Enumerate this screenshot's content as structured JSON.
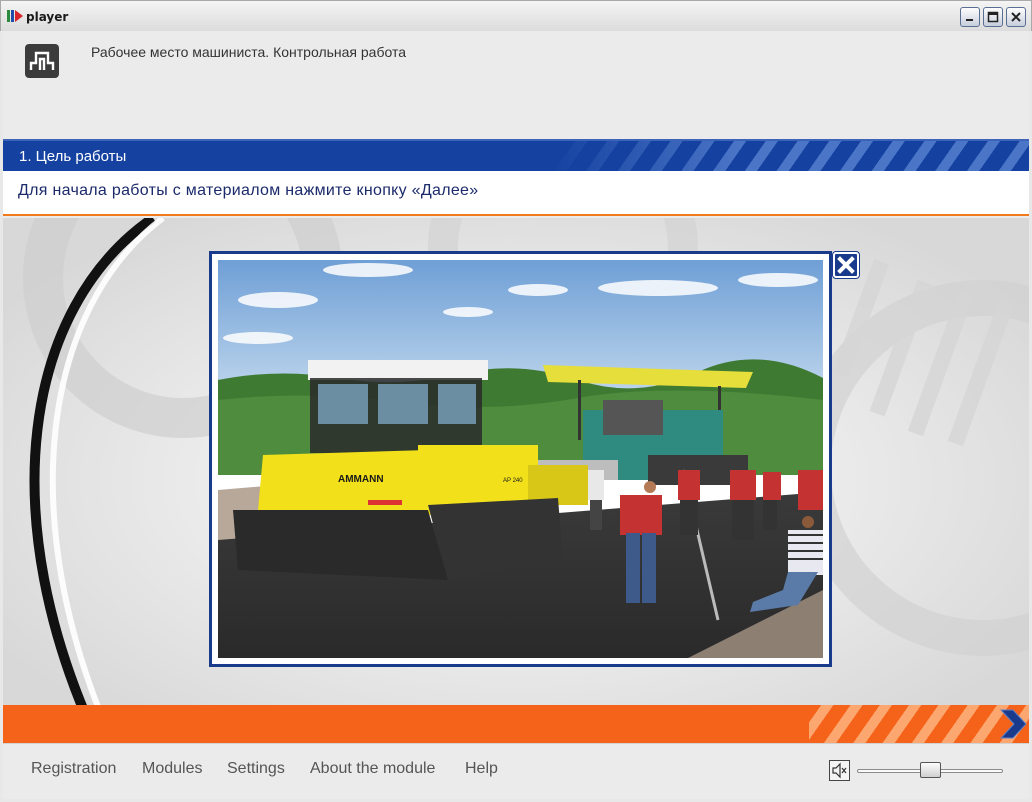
{
  "window": {
    "title": "player",
    "icon": "player-app-icon",
    "controls": [
      "minimize-icon",
      "maximize-icon",
      "close-icon"
    ]
  },
  "header": {
    "logo": "pi-logo-icon",
    "course_title": "Рабочее место машиниста. Контрольная работа"
  },
  "section": {
    "title": "1. Цель работы",
    "instruction": "Для начала работы с материалом нажмите кнопку «Далее»"
  },
  "popup": {
    "image_subject": "asphalt paving roller and workers on road",
    "close_icon": "close-icon",
    "photo_labels": {
      "roller_brand": "AMMANN",
      "roller_model": "AP 240"
    }
  },
  "navigation": {
    "next_icon": "chevron-right-icon"
  },
  "footer": {
    "menu": [
      "Registration",
      "Modules",
      "Settings",
      "About the module",
      "Help"
    ],
    "volume_icon": "speaker-icon",
    "volume_level": 0.45
  },
  "colors": {
    "section_blue": "#1542a1",
    "accent_orange": "#f5631a",
    "instruction_text": "#1b2a6b"
  }
}
